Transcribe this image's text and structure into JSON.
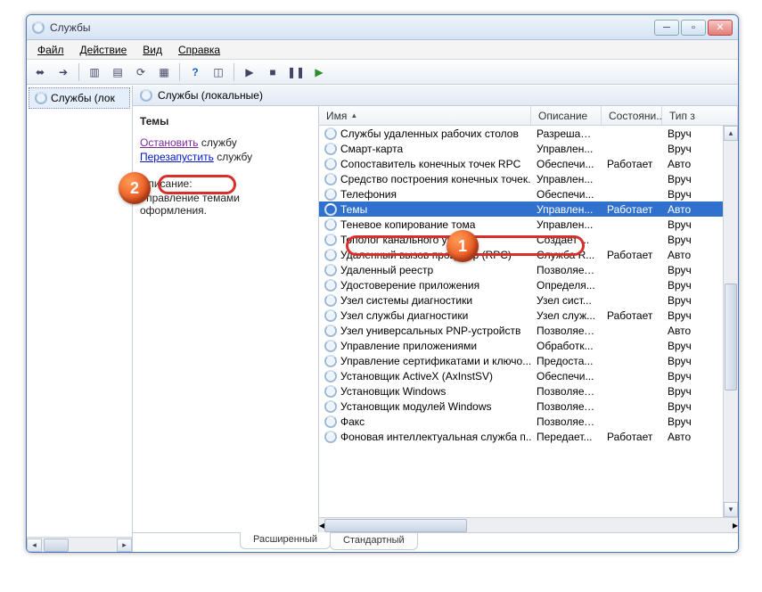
{
  "window": {
    "title": "Службы"
  },
  "menu": {
    "items": [
      "Файл",
      "Действие",
      "Вид",
      "Справка"
    ]
  },
  "tree": {
    "node": "Службы (лок"
  },
  "pane_title": "Службы (локальные)",
  "details": {
    "service_name": "Темы",
    "links": {
      "stop": "Остановить",
      "stop_suffix": "службу",
      "restart": "Перезапустить",
      "restart_suffix": "службу"
    },
    "desc_hdr": "Описание:",
    "desc_text": "Управление темами оформления."
  },
  "columns": {
    "name": "Имя",
    "desc": "Описание",
    "state": "Состояни...",
    "type": "Тип з"
  },
  "tabs": {
    "extended": "Расширенный",
    "standard": "Стандартный"
  },
  "callouts": {
    "b1": "1",
    "b2": "2"
  },
  "services": [
    {
      "name": "Службы удаленных рабочих столов",
      "desc": "Разрешает...",
      "state": "",
      "type": "Вруч"
    },
    {
      "name": "Смарт-карта",
      "desc": "Управлен...",
      "state": "",
      "type": "Вруч"
    },
    {
      "name": "Сопоставитель конечных точек RPC",
      "desc": "Обеспечи...",
      "state": "Работает",
      "type": "Авто"
    },
    {
      "name": "Средство построения конечных точек...",
      "desc": "Управлен...",
      "state": "",
      "type": "Вруч"
    },
    {
      "name": "Телефония",
      "desc": "Обеспечи...",
      "state": "",
      "type": "Вруч"
    },
    {
      "name": "Темы",
      "desc": "Управлен...",
      "state": "Работает",
      "type": "Авто",
      "selected": true
    },
    {
      "name": "Теневое копирование тома",
      "desc": "Управлен...",
      "state": "",
      "type": "Вруч"
    },
    {
      "name": "Тополог канального уровня",
      "desc": "Создает  ...",
      "state": "",
      "type": "Вруч"
    },
    {
      "name": "Удаленный вызов процедур (RPC)",
      "desc": "Служба R...",
      "state": "Работает",
      "type": "Авто"
    },
    {
      "name": "Удаленный реестр",
      "desc": "Позволяет...",
      "state": "",
      "type": "Вруч"
    },
    {
      "name": "Удостоверение приложения",
      "desc": "Определя...",
      "state": "",
      "type": "Вруч"
    },
    {
      "name": "Узел системы диагностики",
      "desc": "Узел сист...",
      "state": "",
      "type": "Вруч"
    },
    {
      "name": "Узел службы диагностики",
      "desc": "Узел служ...",
      "state": "Работает",
      "type": "Вруч"
    },
    {
      "name": "Узел универсальных PNP-устройств",
      "desc": "Позволяет...",
      "state": "",
      "type": "Авто"
    },
    {
      "name": "Управление приложениями",
      "desc": "Обработк...",
      "state": "",
      "type": "Вруч"
    },
    {
      "name": "Управление сертификатами и ключо...",
      "desc": "Предоста...",
      "state": "",
      "type": "Вруч"
    },
    {
      "name": "Установщик ActiveX (AxInstSV)",
      "desc": "Обеспечи...",
      "state": "",
      "type": "Вруч"
    },
    {
      "name": "Установщик Windows",
      "desc": "Позволяет...",
      "state": "",
      "type": "Вруч"
    },
    {
      "name": "Установщик модулей Windows",
      "desc": "Позволяет...",
      "state": "",
      "type": "Вруч"
    },
    {
      "name": "Факс",
      "desc": "Позволяет...",
      "state": "",
      "type": "Вруч"
    },
    {
      "name": "Фоновая интеллектуальная служба п...",
      "desc": "Передает...",
      "state": "Работает",
      "type": "Авто"
    }
  ]
}
